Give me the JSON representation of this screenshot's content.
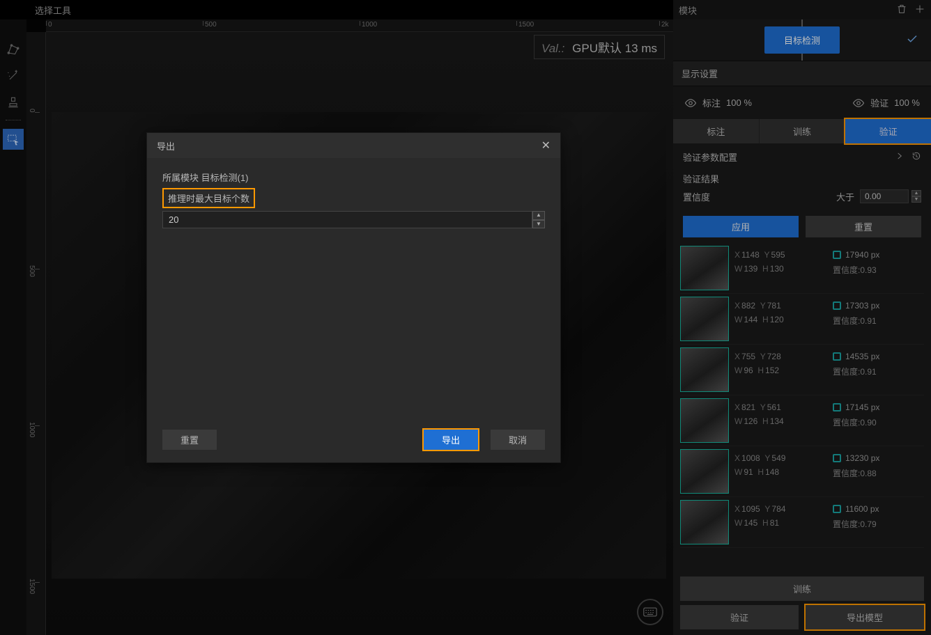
{
  "top_toolbar": {
    "label": "选择工具"
  },
  "ruler_h": [
    "0",
    "500",
    "1000",
    "1500",
    "2k"
  ],
  "ruler_v": [
    "0",
    "500",
    "1000",
    "1500"
  ],
  "canvas": {
    "val_prefix": "Val.:",
    "val_text": "GPU默认 13 ms"
  },
  "right": {
    "header": "模块",
    "module_button": "目标检测",
    "section_display": "显示设置",
    "annotate_label": "标注",
    "annotate_pct": "100 %",
    "verify_label": "验证",
    "verify_pct": "100 %",
    "inner_tabs": {
      "t1": "标注",
      "t2": "训练",
      "t3": "验证"
    },
    "cfg_label": "验证参数配置",
    "results_title": "验证结果",
    "confidence_label": "置信度",
    "gt_label": "大于",
    "gt_value": "0.00",
    "apply": "应用",
    "reset": "重置",
    "bottom": {
      "train": "训练",
      "verify": "验证",
      "export": "导出模型"
    }
  },
  "results": [
    {
      "x": "1148",
      "y": "595",
      "w": "139",
      "h": "130",
      "px": "17940 px",
      "conf": "置信度:0.93"
    },
    {
      "x": "882",
      "y": "781",
      "w": "144",
      "h": "120",
      "px": "17303 px",
      "conf": "置信度:0.91"
    },
    {
      "x": "755",
      "y": "728",
      "w": "96",
      "h": "152",
      "px": "14535 px",
      "conf": "置信度:0.91"
    },
    {
      "x": "821",
      "y": "561",
      "w": "126",
      "h": "134",
      "px": "17145 px",
      "conf": "置信度:0.90"
    },
    {
      "x": "1008",
      "y": "549",
      "w": "91",
      "h": "148",
      "px": "13230 px",
      "conf": "置信度:0.88"
    },
    {
      "x": "1095",
      "y": "784",
      "w": "145",
      "h": "81",
      "px": "11600 px",
      "conf": "置信度:0.79"
    }
  ],
  "modal": {
    "title": "导出",
    "module_line": "所属模块 目标检测(1)",
    "field_label": "推理时最大目标个数",
    "field_value": "20",
    "reset": "重置",
    "export": "导出",
    "cancel": "取消"
  }
}
